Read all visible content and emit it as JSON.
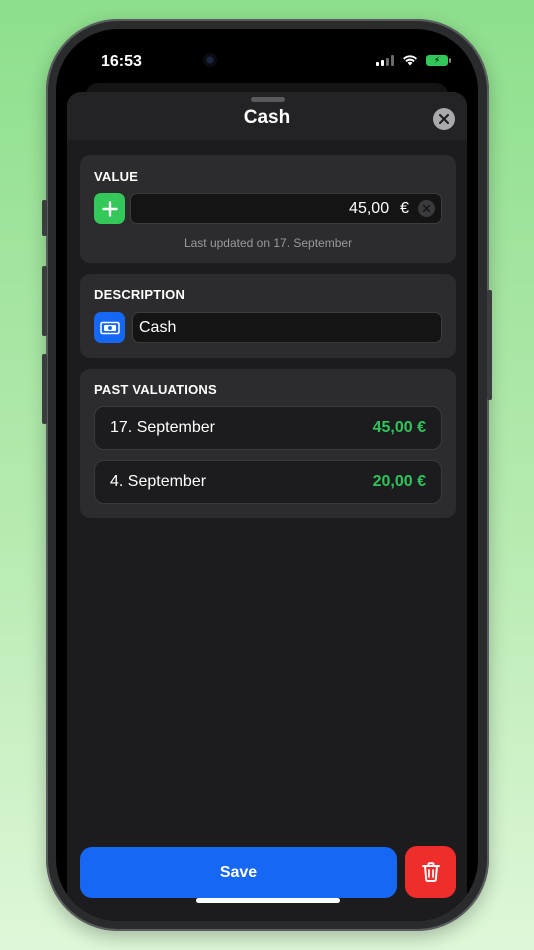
{
  "status_bar": {
    "time": "16:53"
  },
  "sheet": {
    "title": "Cash",
    "value_section": {
      "title": "VALUE",
      "amount": "45,00",
      "currency": "€",
      "last_updated": "Last updated on 17. September"
    },
    "description_section": {
      "title": "DESCRIPTION",
      "value": "Cash"
    },
    "past_valuations": {
      "title": "PAST VALUATIONS",
      "items": [
        {
          "date": "17. September",
          "amount": "45,00 €"
        },
        {
          "date": "4. September",
          "amount": "20,00 €"
        }
      ]
    },
    "save_label": "Save"
  },
  "colors": {
    "accent": "#1767f5",
    "add": "#34c759",
    "positive": "#31c25b",
    "danger": "#ef2d2b"
  },
  "icons": {
    "close": "close-icon",
    "add": "plus-icon",
    "clear": "clear-icon",
    "description": "banknote-icon",
    "delete": "trash-icon"
  }
}
